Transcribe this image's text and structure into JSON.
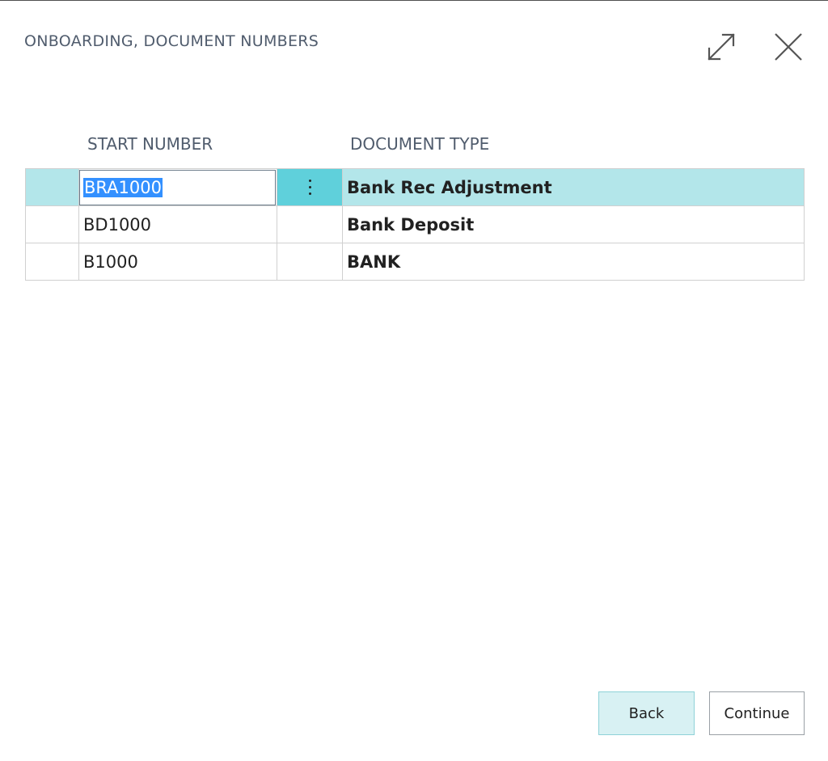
{
  "dialog": {
    "title": "ONBOARDING, DOCUMENT NUMBERS",
    "expand_icon": "expand-arrows-icon",
    "close_icon": "close-icon"
  },
  "table": {
    "columns": [
      "START NUMBER",
      "DOCUMENT TYPE"
    ],
    "rows": [
      {
        "start_number": "BRA1000",
        "document_type": "Bank Rec Adjustment",
        "selected": true
      },
      {
        "start_number": "BD1000",
        "document_type": "Bank Deposit",
        "selected": false
      },
      {
        "start_number": "B1000",
        "document_type": "BANK",
        "selected": false
      }
    ]
  },
  "footer": {
    "back_label": "Back",
    "continue_label": "Continue"
  },
  "colors": {
    "selected_row": "#b3e6ea",
    "menu_cell": "#5fd0db",
    "back_button_bg": "#d8f1f3",
    "title_text": "#505c6d"
  }
}
